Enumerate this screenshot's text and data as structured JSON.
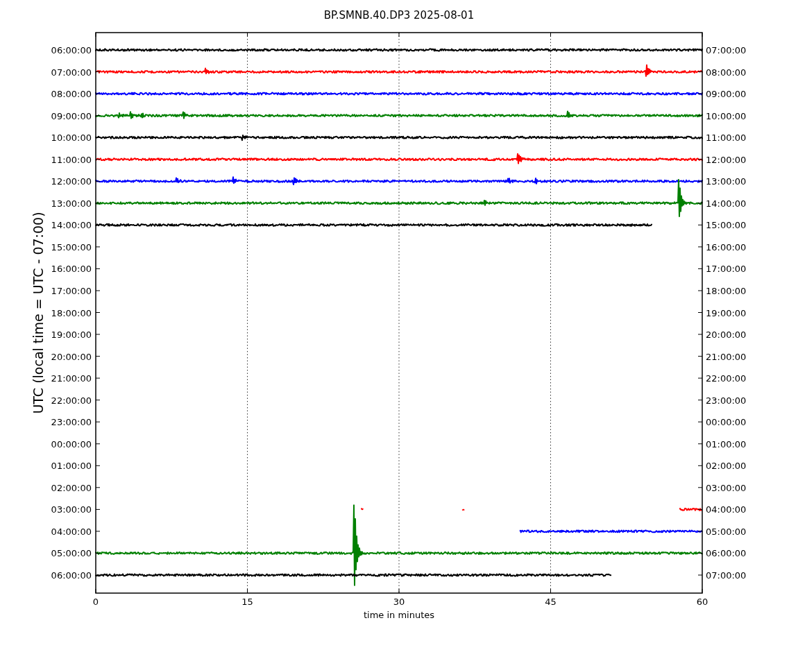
{
  "chart": {
    "title": "BP.SMNB.40.DP3 2025-08-01",
    "ylabel": "UTC (local time = UTC - 07:00)",
    "xlabel": "time in minutes",
    "xticks": [
      "0",
      "15",
      "30",
      "45",
      "60"
    ],
    "rows": [
      {
        "left_label": "06:00:00",
        "right_label": "07:00:00",
        "color": "#000000"
      },
      {
        "left_label": "07:00:00",
        "right_label": "08:00:00",
        "color": "#ff0000"
      },
      {
        "left_label": "08:00:00",
        "right_label": "09:00:00",
        "color": "#0000ff"
      },
      {
        "left_label": "09:00:00",
        "right_label": "10:00:00",
        "color": "#008000"
      },
      {
        "left_label": "10:00:00",
        "right_label": "11:00:00",
        "color": "#000000"
      },
      {
        "left_label": "11:00:00",
        "right_label": "12:00:00",
        "color": "#ff0000"
      },
      {
        "left_label": "12:00:00",
        "right_label": "13:00:00",
        "color": "#0000ff"
      },
      {
        "left_label": "13:00:00",
        "right_label": "14:00:00",
        "color": "#008000"
      },
      {
        "left_label": "14:00:00",
        "right_label": "15:00:00",
        "color": "#000000"
      },
      {
        "left_label": "15:00:00",
        "right_label": "16:00:00"
      },
      {
        "left_label": "16:00:00",
        "right_label": "17:00:00"
      },
      {
        "left_label": "17:00:00",
        "right_label": "18:00:00"
      },
      {
        "left_label": "18:00:00",
        "right_label": "19:00:00"
      },
      {
        "left_label": "19:00:00",
        "right_label": "20:00:00"
      },
      {
        "left_label": "20:00:00",
        "right_label": "21:00:00"
      },
      {
        "left_label": "21:00:00",
        "right_label": "22:00:00"
      },
      {
        "left_label": "22:00:00",
        "right_label": "23:00:00"
      },
      {
        "left_label": "23:00:00",
        "right_label": "00:00:00"
      },
      {
        "left_label": "00:00:00",
        "right_label": "01:00:00"
      },
      {
        "left_label": "01:00:00",
        "right_label": "02:00:00"
      },
      {
        "left_label": "02:00:00",
        "right_label": "03:00:00"
      },
      {
        "left_label": "03:00:00",
        "right_label": "04:00:00",
        "color": "#ff0000"
      },
      {
        "left_label": "04:00:00",
        "right_label": "05:00:00",
        "color": "#0000ff"
      },
      {
        "left_label": "05:00:00",
        "right_label": "06:00:00",
        "color": "#008000"
      },
      {
        "left_label": "06:00:00",
        "right_label": "07:00:00",
        "color": "#000000"
      }
    ]
  }
}
